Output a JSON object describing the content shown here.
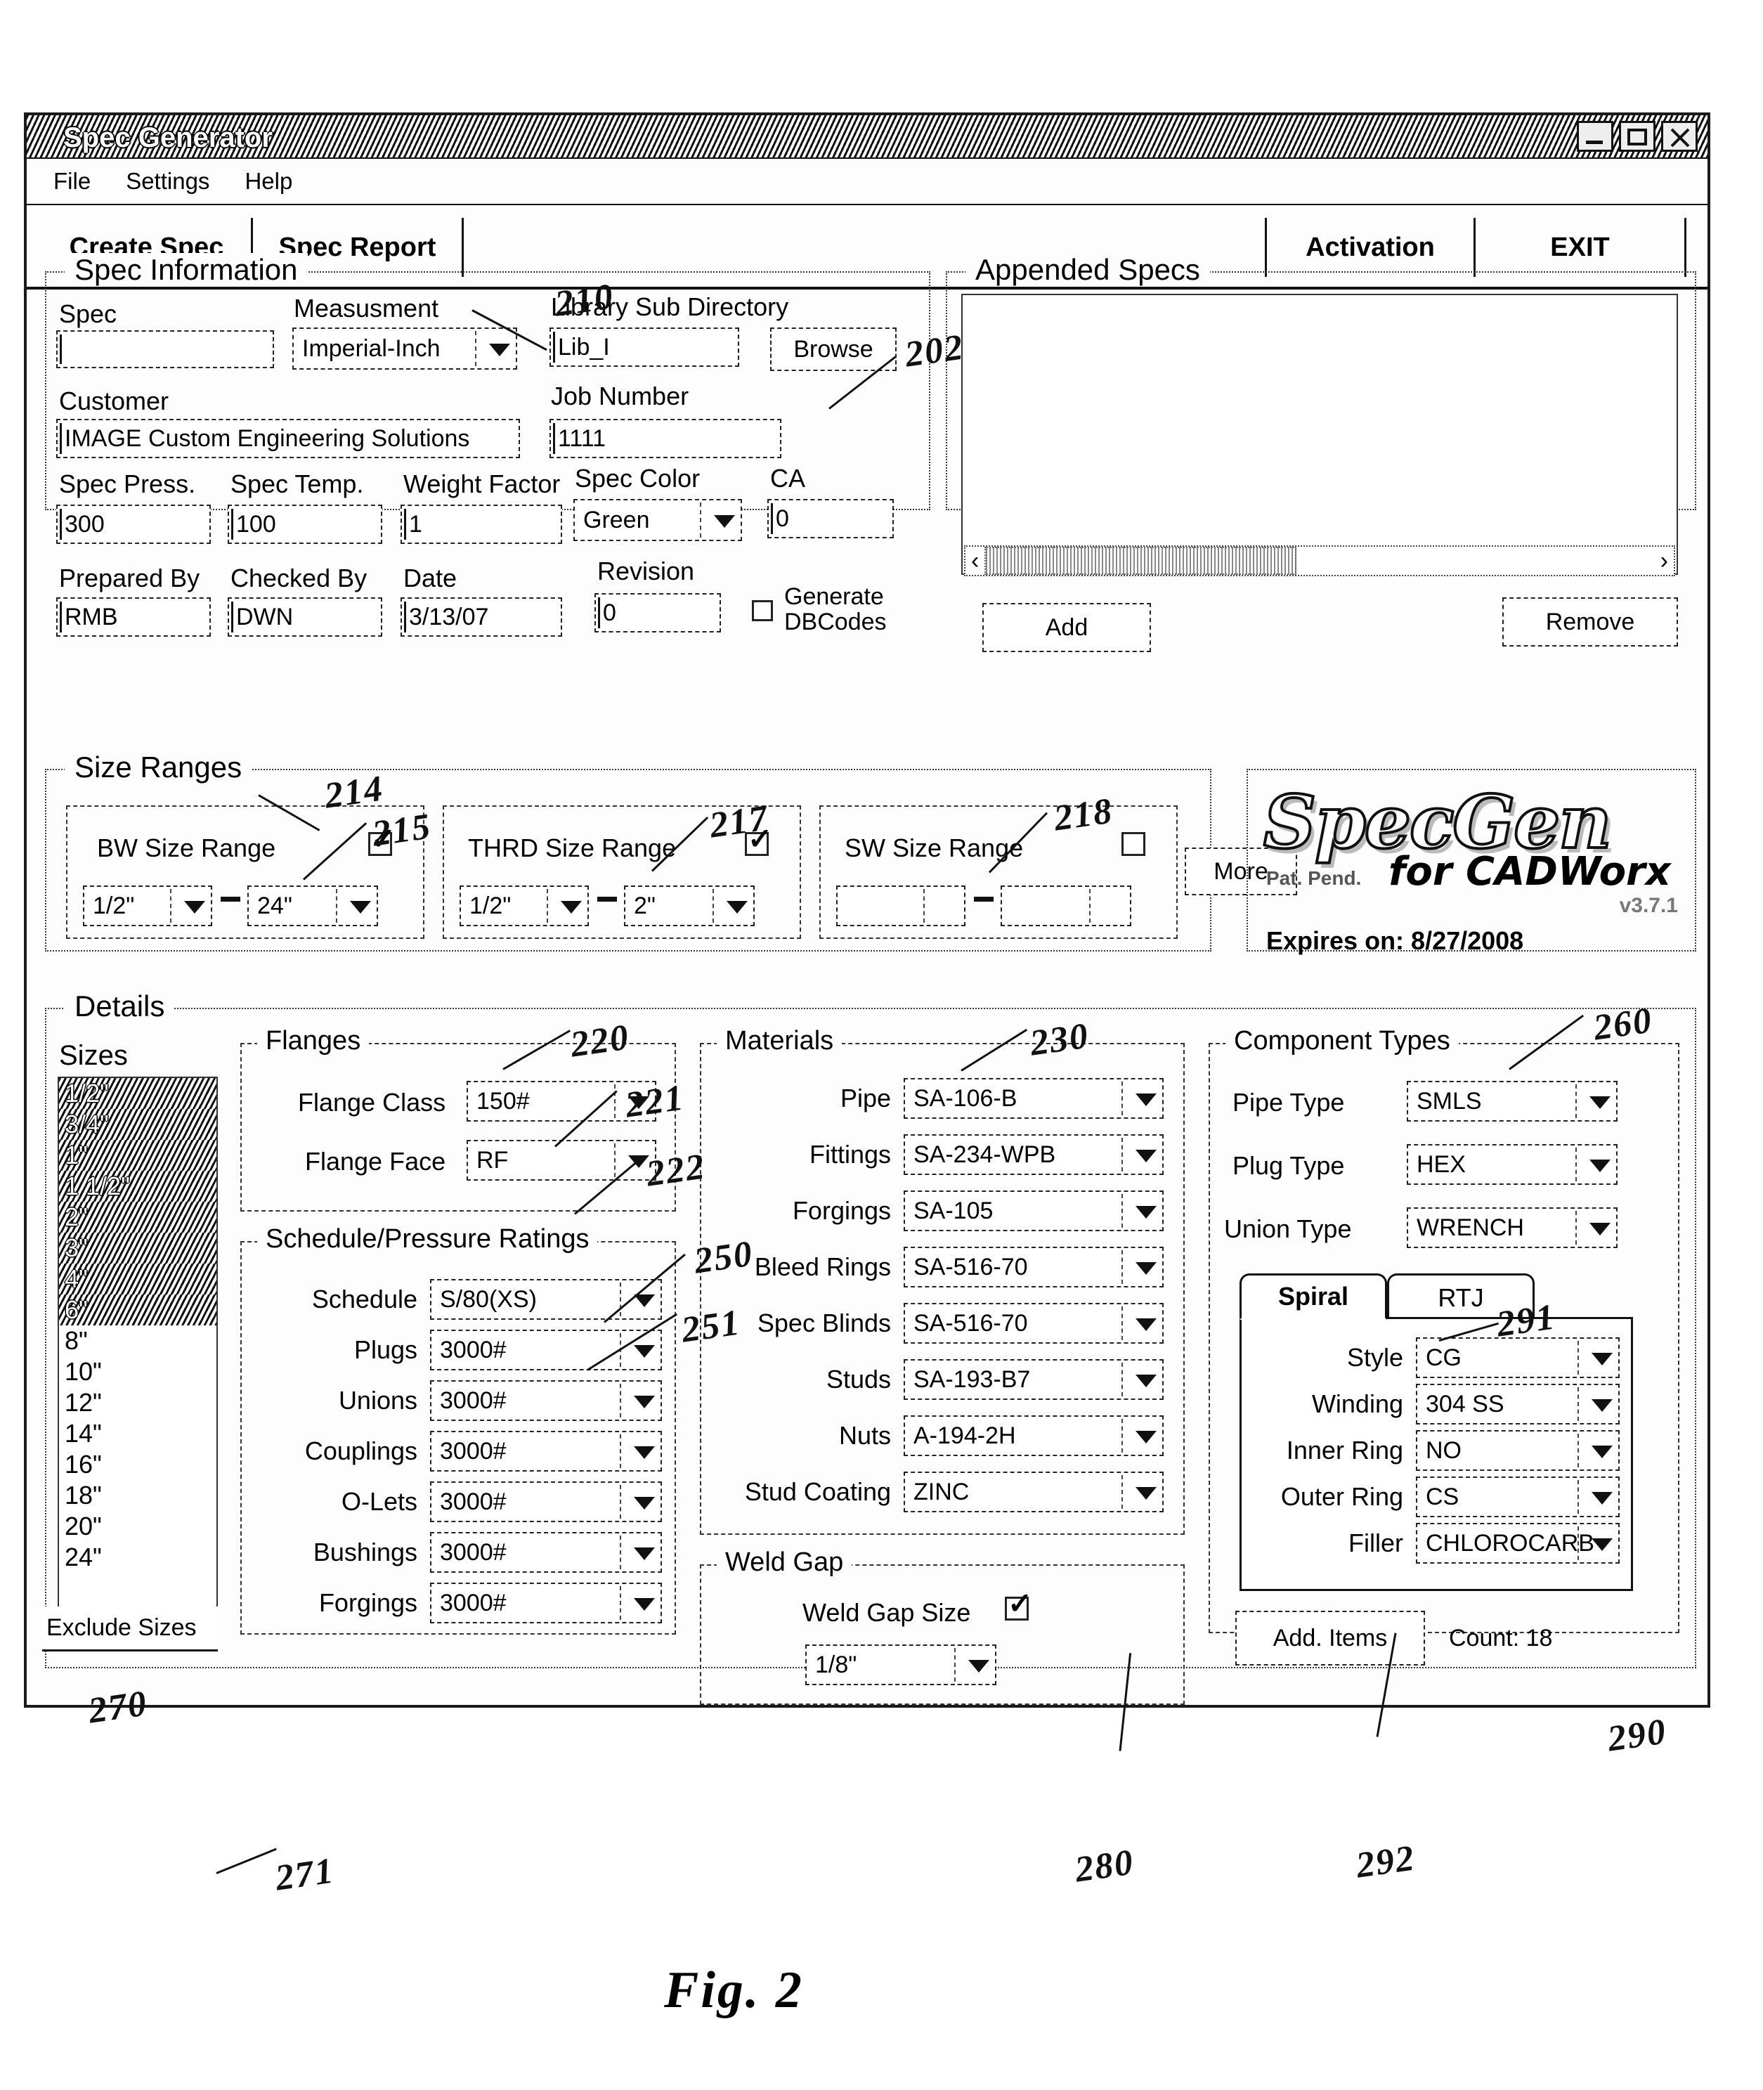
{
  "window": {
    "title": "Spec Generator"
  },
  "menubar": {
    "items": [
      "File",
      "Settings",
      "Help"
    ]
  },
  "toolbar": {
    "create_spec": "Create Spec",
    "spec_report": "Spec Report",
    "activation": "Activation",
    "exit": "EXIT"
  },
  "spec_information": {
    "title": "Spec Information",
    "spec_label": "Spec",
    "spec_value": "",
    "measurement_label": "Measusment",
    "measurement_value": "Imperial-Inch",
    "library_label": "Library Sub Directory",
    "library_value": "Lib_I",
    "browse_label": "Browse",
    "customer_label": "Customer",
    "customer_value": "IMAGE Custom Engineering Solutions",
    "job_number_label": "Job Number",
    "job_number_value": "1111",
    "spec_press_label": "Spec Press.",
    "spec_press_value": "300",
    "spec_temp_label": "Spec Temp.",
    "spec_temp_value": "100",
    "weight_factor_label": "Weight Factor",
    "weight_factor_value": "1",
    "spec_color_label": "Spec Color",
    "spec_color_value": "Green",
    "ca_label": "CA",
    "ca_value": "0",
    "prepared_by_label": "Prepared By",
    "prepared_by_value": "RMB",
    "checked_by_label": "Checked By",
    "checked_by_value": "DWN",
    "date_label": "Date",
    "date_value": "3/13/07",
    "revision_label": "Revision",
    "revision_value": "0",
    "generate_dbcodes_label": "Generate DBCodes",
    "generate_dbcodes_checked": false
  },
  "appended_specs": {
    "title": "Appended Specs",
    "items": [],
    "add_label": "Add",
    "remove_label": "Remove",
    "scroll_left": "‹",
    "scroll_right": "›"
  },
  "size_ranges": {
    "title": "Size Ranges",
    "ranges": [
      {
        "label": "BW Size Range",
        "checked": true,
        "from": "1/2\"",
        "to": "24\""
      },
      {
        "label": "THRD Size Range",
        "checked": true,
        "from": "1/2\"",
        "to": "2\""
      },
      {
        "label": "SW Size Range",
        "checked": false,
        "from": "",
        "to": ""
      }
    ],
    "more_label": "More"
  },
  "logo": {
    "name": "SpecGen",
    "patent": "Pat. Pend.",
    "tagline": "for CADWorx",
    "version": "v3.7.1",
    "expires": "Expires on: 8/27/2008"
  },
  "details": {
    "title": "Details",
    "sizes_label": "Sizes",
    "sizes": [
      {
        "label": "1/2\"",
        "selected": true
      },
      {
        "label": "3/4\"",
        "selected": true
      },
      {
        "label": "1\"",
        "selected": true
      },
      {
        "label": "1 1/2\"",
        "selected": true
      },
      {
        "label": "2\"",
        "selected": true
      },
      {
        "label": "3\"",
        "selected": true
      },
      {
        "label": "4\"",
        "selected": true
      },
      {
        "label": "6\"",
        "selected": true
      },
      {
        "label": "8\"",
        "selected": false
      },
      {
        "label": "10\"",
        "selected": false
      },
      {
        "label": "12\"",
        "selected": false
      },
      {
        "label": "14\"",
        "selected": false
      },
      {
        "label": "16\"",
        "selected": false
      },
      {
        "label": "18\"",
        "selected": false
      },
      {
        "label": "20\"",
        "selected": false
      },
      {
        "label": "24\"",
        "selected": false
      }
    ],
    "exclude_sizes_label": "Exclude Sizes"
  },
  "flanges": {
    "title": "Flanges",
    "rows": [
      {
        "label": "Flange Class",
        "value": "150#"
      },
      {
        "label": "Flange Face",
        "value": "RF"
      }
    ]
  },
  "schedule": {
    "title": "Schedule/Pressure Ratings",
    "rows": [
      {
        "label": "Schedule",
        "value": "S/80(XS)"
      },
      {
        "label": "Plugs",
        "value": "3000#"
      },
      {
        "label": "Unions",
        "value": "3000#"
      },
      {
        "label": "Couplings",
        "value": "3000#"
      },
      {
        "label": "O-Lets",
        "value": "3000#"
      },
      {
        "label": "Bushings",
        "value": "3000#"
      },
      {
        "label": "Forgings",
        "value": "3000#"
      }
    ]
  },
  "materials": {
    "title": "Materials",
    "rows": [
      {
        "label": "Pipe",
        "value": "SA-106-B"
      },
      {
        "label": "Fittings",
        "value": "SA-234-WPB"
      },
      {
        "label": "Forgings",
        "value": "SA-105"
      },
      {
        "label": "Bleed Rings",
        "value": "SA-516-70"
      },
      {
        "label": "Spec Blinds",
        "value": "SA-516-70"
      },
      {
        "label": "Studs",
        "value": "SA-193-B7"
      },
      {
        "label": "Nuts",
        "value": "A-194-2H"
      },
      {
        "label": "Stud Coating",
        "value": "ZINC"
      }
    ]
  },
  "weld_gap": {
    "title": "Weld Gap",
    "size_label": "Weld Gap Size",
    "checked": true,
    "value": "1/8\""
  },
  "component_types": {
    "title": "Component Types",
    "rows": [
      {
        "label": "Pipe Type",
        "value": "SMLS"
      },
      {
        "label": "Plug Type",
        "value": "HEX"
      },
      {
        "label": "Union Type",
        "value": "WRENCH"
      }
    ],
    "tabs": [
      {
        "label": "Spiral",
        "active": true
      },
      {
        "label": "RTJ",
        "active": false
      }
    ],
    "gasket_rows": [
      {
        "label": "Style",
        "value": "CG"
      },
      {
        "label": "Winding",
        "value": "304 SS"
      },
      {
        "label": "Inner Ring",
        "value": "NO"
      },
      {
        "label": "Outer Ring",
        "value": "CS"
      },
      {
        "label": "Filler",
        "value": "CHLOROCARB"
      }
    ],
    "add_items_label": "Add. Items",
    "count_label": "Count: 18"
  },
  "annotations": {
    "a202": "202",
    "a210": "210",
    "a214": "214",
    "a215": "215",
    "a217": "217",
    "a218": "218",
    "a220": "220",
    "a221": "221",
    "a222": "222",
    "a230": "230",
    "a250": "250",
    "a251": "251",
    "a260": "260",
    "a270": "270",
    "a271": "271",
    "a280": "280",
    "a290": "290",
    "a291": "291",
    "a292": "292"
  },
  "figure_caption": "Fig. 2"
}
